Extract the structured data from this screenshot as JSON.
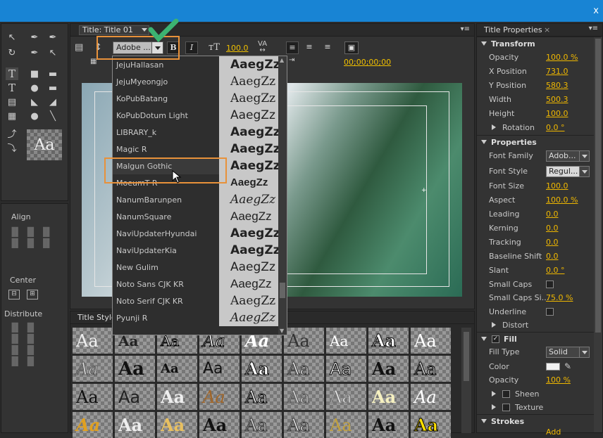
{
  "window": {
    "close_glyph": "x"
  },
  "title_panel": {
    "tab_label": "Title: Title 01",
    "font_family_value": "Adobe ...",
    "bold_label": "B",
    "italic_label": "I",
    "font_size_value": "100.0",
    "timecode": "00;00;00;00"
  },
  "font_list": [
    {
      "name": "JejuHallasan",
      "sample": "AaegZz"
    },
    {
      "name": "JejuMyeongjo",
      "sample": "AaegZz"
    },
    {
      "name": "KoPubBatang",
      "sample": "AaegZz"
    },
    {
      "name": "KoPubDotum Light",
      "sample": "AaegZz"
    },
    {
      "name": "LIBRARY_k",
      "sample": "AaegZz"
    },
    {
      "name": "Magic R",
      "sample": "AaegZz"
    },
    {
      "name": "Malgun Gothic",
      "sample": "AaegZz"
    },
    {
      "name": "MoeumT R",
      "sample": "AaegZz"
    },
    {
      "name": "NanumBarunpen",
      "sample": "AaegZz"
    },
    {
      "name": "NanumSquare",
      "sample": "AaegZz"
    },
    {
      "name": "NaviUpdaterHyundai",
      "sample": "AaegZz"
    },
    {
      "name": "NaviUpdaterKia",
      "sample": "AaegZz"
    },
    {
      "name": "New Gulim",
      "sample": "AaegZz"
    },
    {
      "name": "Noto Sans CJK KR",
      "sample": "AaegZz"
    },
    {
      "name": "Noto Serif CJK KR",
      "sample": "AaegZz"
    },
    {
      "name": "Pyunji R",
      "sample": "AaegZz"
    }
  ],
  "highlighted_font": "Malgun Gothic",
  "tools_panel": {
    "preview_text": "Aa"
  },
  "align_panel": {
    "align_label": "Align",
    "center_label": "Center",
    "distribute_label": "Distribute"
  },
  "title_styles": {
    "tab_label": "Title Style",
    "sample_text": "Aa"
  },
  "properties": {
    "tab_label": "Title Properties",
    "transform_label": "Transform",
    "opacity_label": "Opacity",
    "opacity_value": "100.0 %",
    "xpos_label": "X Position",
    "xpos_value": "731.0",
    "ypos_label": "Y Position",
    "ypos_value": "580.3",
    "width_label": "Width",
    "width_value": "500.3",
    "height_label": "Height",
    "height_value": "100.0",
    "rotation_label": "Rotation",
    "rotation_value": "0.0 °",
    "properties_label": "Properties",
    "font_family_label": "Font Family",
    "font_family_value": "Adob...",
    "font_style_label": "Font Style",
    "font_style_value": "Regul...",
    "font_size_label": "Font Size",
    "font_size_value": "100.0",
    "aspect_label": "Aspect",
    "aspect_value": "100.0 %",
    "leading_label": "Leading",
    "leading_value": "0.0",
    "kerning_label": "Kerning",
    "kerning_value": "0.0",
    "tracking_label": "Tracking",
    "tracking_value": "0.0",
    "baseline_label": "Baseline Shift",
    "baseline_value": "0.0",
    "slant_label": "Slant",
    "slant_value": "0.0 °",
    "smallcaps_label": "Small Caps",
    "smallcaps_size_label": "Small Caps Si...",
    "smallcaps_size_value": "75.0 %",
    "underline_label": "Underline",
    "distort_label": "Distort",
    "fill_label": "Fill",
    "fill_type_label": "Fill Type",
    "fill_type_value": "Solid",
    "color_label": "Color",
    "fill_opacity_label": "Opacity",
    "fill_opacity_value": "100 %",
    "sheen_label": "Sheen",
    "texture_label": "Texture",
    "strokes_label": "Strokes",
    "inner_stroke_partial": "Add"
  },
  "colors": {
    "accent_value": "#f0b800",
    "titlebar": "#1884d4",
    "highlight_box": "#e8913a",
    "checkmark": "#3cb371"
  }
}
